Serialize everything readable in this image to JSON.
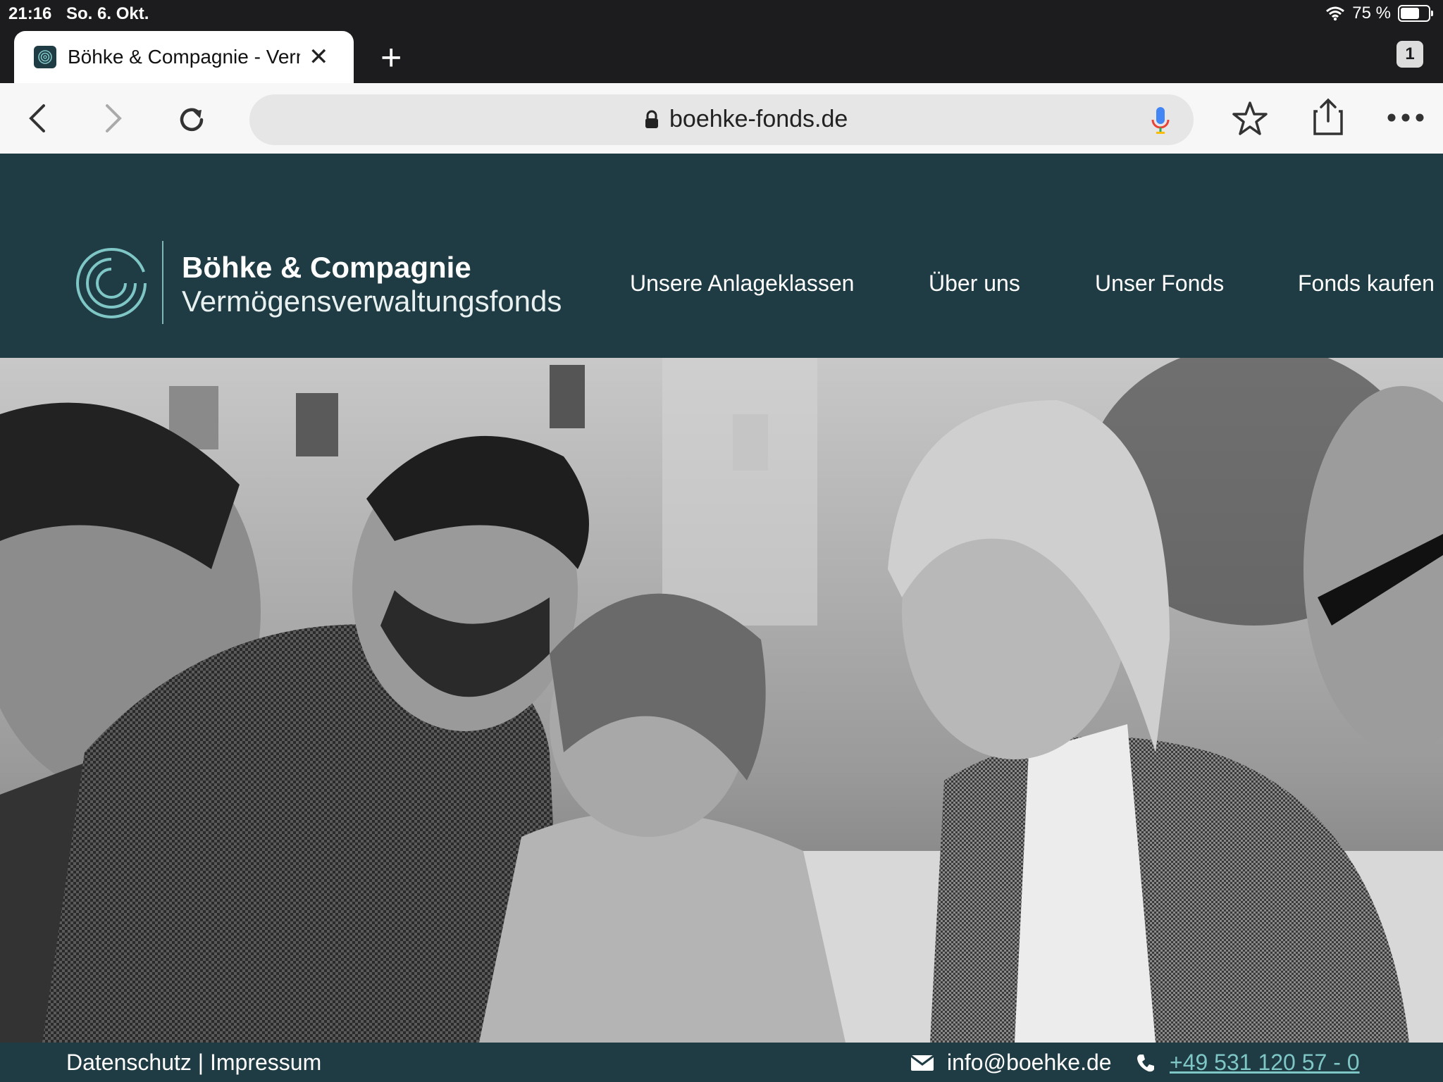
{
  "status": {
    "time": "21:16",
    "date": "So. 6. Okt.",
    "battery": "75 %",
    "battery_level": 0.75
  },
  "browser": {
    "tab_title": "Böhke & Compagnie - Verm",
    "tab_count": "1",
    "url": "boehke-fonds.de",
    "icons": [
      "back-icon",
      "forward-icon",
      "reload-icon",
      "lock-icon",
      "mic-icon",
      "bookmark-star-icon",
      "share-icon",
      "more-icon",
      "close-icon",
      "plus-icon"
    ]
  },
  "site": {
    "brand_name": "Böhke & Compagnie",
    "brand_sub": "Vermögensverwaltungsfonds",
    "nav": [
      "Unsere Anlageklassen",
      "Über uns",
      "Unser Fonds",
      "Fonds kaufen"
    ],
    "colors": {
      "header": "#1f3b43",
      "accent": "#7fc6c6"
    }
  },
  "footer": {
    "privacy": "Datenschutz",
    "separator": " | ",
    "imprint": "Impressum",
    "email": "info@boehke.de",
    "phone": "+49 531 120 57 - 0"
  }
}
